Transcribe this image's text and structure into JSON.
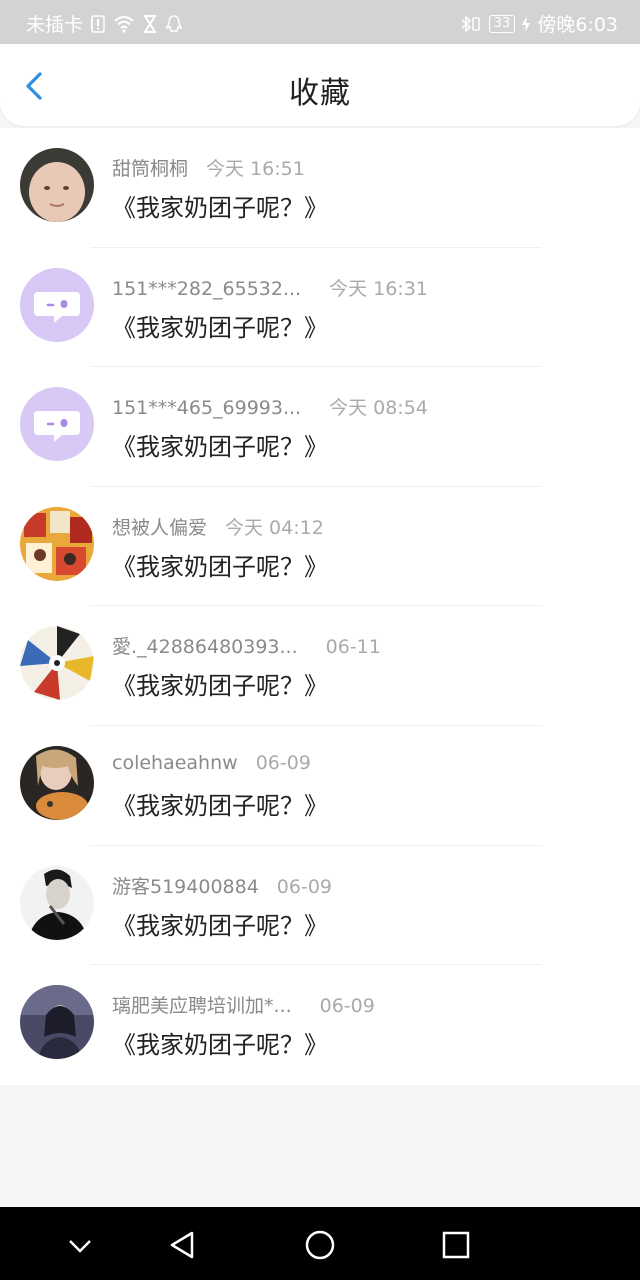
{
  "status_bar": {
    "carrier": "未插卡",
    "battery": "33",
    "time": "傍晚6:03"
  },
  "header": {
    "title": "收藏",
    "back_icon": "chevron-left-icon"
  },
  "items": [
    {
      "user": "甜筒桐桐",
      "time": "今天 16:51",
      "book": "《我家奶团子呢？》",
      "avatar": "photo-baby"
    },
    {
      "user": "151***282_65532...",
      "time": "今天 16:31",
      "book": "《我家奶团子呢？》",
      "avatar": "default-chat"
    },
    {
      "user": "151***465_69993...",
      "time": "今天 08:54",
      "book": "《我家奶团子呢？》",
      "avatar": "default-chat"
    },
    {
      "user": "想被人偏爱",
      "time": "今天 04:12",
      "book": "《我家奶团子呢？》",
      "avatar": "photo-collage"
    },
    {
      "user": "愛._42886480393...",
      "time": "06-11",
      "book": "《我家奶团子呢？》",
      "avatar": "photo-collage-2"
    },
    {
      "user": "colehaeahnw",
      "time": "06-09",
      "book": "《我家奶团子呢？》",
      "avatar": "photo-girl-cat"
    },
    {
      "user": "游客519400884",
      "time": "06-09",
      "book": "《我家奶团子呢？》",
      "avatar": "photo-man"
    },
    {
      "user": "璃肥美应聘培训加*...",
      "time": "06-09",
      "book": "《我家奶团子呢？》",
      "avatar": "photo-dark"
    }
  ],
  "colors": {
    "accent": "#2f8de4",
    "default_avatar": "#d7c8f5"
  }
}
